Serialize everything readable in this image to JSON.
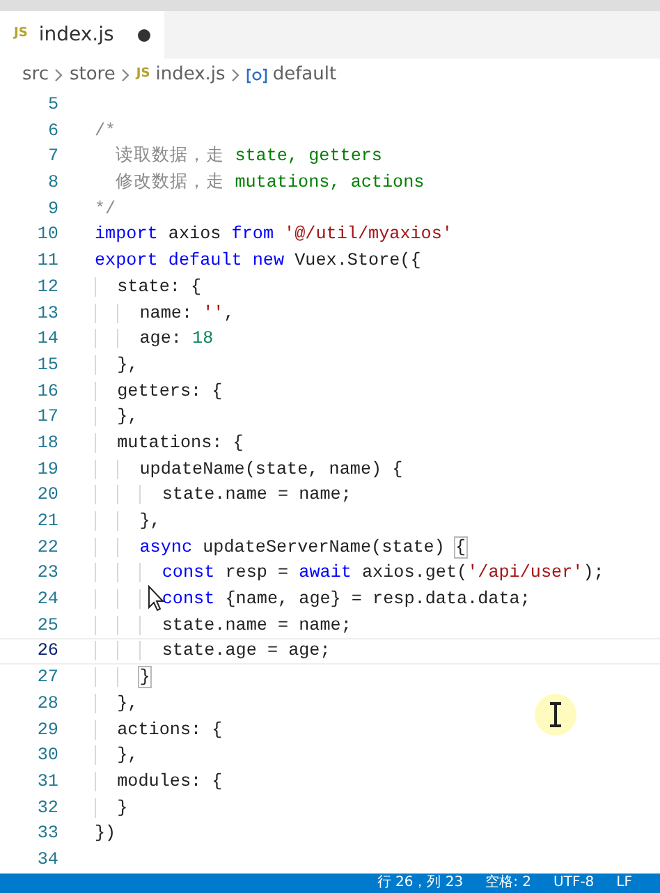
{
  "tab": {
    "icon_label": "JS",
    "title": "index.js",
    "modified": true,
    "selected": true
  },
  "breadcrumbs": [
    {
      "kind": "folder",
      "label": "src"
    },
    {
      "kind": "folder",
      "label": "store"
    },
    {
      "kind": "file",
      "icon_label": "JS",
      "label": "index.js"
    },
    {
      "kind": "symbol",
      "label": "default"
    }
  ],
  "lines": [
    {
      "number": "5",
      "selected": false
    },
    {
      "number": "6",
      "selected": false,
      "tokens": [
        {
          "kind": "comment",
          "text": "/*"
        }
      ]
    },
    {
      "number": "7",
      "selected": false,
      "tokens": [
        {
          "kind": "comment",
          "text": "  读取数据，走 "
        },
        {
          "kind": "comment-code",
          "text": "state, getters"
        }
      ]
    },
    {
      "number": "8",
      "selected": false,
      "tokens": [
        {
          "kind": "comment",
          "text": "  修改数据，走 "
        },
        {
          "kind": "comment-code",
          "text": "mutations, actions"
        }
      ]
    },
    {
      "number": "9",
      "selected": false,
      "tokens": [
        {
          "kind": "comment",
          "text": "*/"
        }
      ]
    },
    {
      "number": "10",
      "selected": false,
      "tokens": [
        {
          "kind": "keyword",
          "text": "import"
        },
        {
          "kind": "plain",
          "text": " axios "
        },
        {
          "kind": "keyword",
          "text": "from"
        },
        {
          "kind": "string",
          "text": " '@/util/myaxios'"
        }
      ]
    },
    {
      "number": "11",
      "selected": false,
      "tokens": [
        {
          "kind": "keyword",
          "text": "export default new"
        },
        {
          "kind": "plain",
          "text": " Vuex.Store({"
        }
      ]
    },
    {
      "number": "12",
      "selected": false,
      "tokens": [
        {
          "kind": "plain",
          "text": "  state: {"
        }
      ]
    },
    {
      "number": "13",
      "selected": false,
      "tokens": [
        {
          "kind": "plain",
          "text": "    name: "
        },
        {
          "kind": "string",
          "text": "''"
        },
        {
          "kind": "plain",
          "text": ","
        }
      ]
    },
    {
      "number": "14",
      "selected": false,
      "tokens": [
        {
          "kind": "plain",
          "text": "    age: "
        },
        {
          "kind": "number",
          "text": "18"
        }
      ]
    },
    {
      "number": "15",
      "selected": false,
      "tokens": [
        {
          "kind": "plain",
          "text": "  },"
        }
      ]
    },
    {
      "number": "16",
      "selected": false,
      "tokens": [
        {
          "kind": "plain",
          "text": "  getters: {"
        }
      ]
    },
    {
      "number": "17",
      "selected": false,
      "tokens": [
        {
          "kind": "plain",
          "text": "  },"
        }
      ]
    },
    {
      "number": "18",
      "selected": false,
      "tokens": [
        {
          "kind": "plain",
          "text": "  mutations: {"
        }
      ]
    },
    {
      "number": "19",
      "selected": false,
      "tokens": [
        {
          "kind": "plain",
          "text": "    updateName(state, name) {"
        }
      ]
    },
    {
      "number": "20",
      "selected": false,
      "tokens": [
        {
          "kind": "plain",
          "text": "      state.name = name;"
        }
      ]
    },
    {
      "number": "21",
      "selected": false,
      "tokens": [
        {
          "kind": "plain",
          "text": "    },"
        }
      ]
    },
    {
      "number": "22",
      "selected": false,
      "tokens": [
        {
          "kind": "keyword",
          "text": "    async"
        },
        {
          "kind": "plain",
          "text": " updateServerName(state) "
        },
        {
          "kind": "bracket-match",
          "text": "{"
        }
      ]
    },
    {
      "number": "23",
      "selected": false,
      "tokens": [
        {
          "kind": "keyword",
          "text": "      const"
        },
        {
          "kind": "plain",
          "text": " resp = "
        },
        {
          "kind": "keyword",
          "text": "await"
        },
        {
          "kind": "plain",
          "text": " axios.get("
        },
        {
          "kind": "string",
          "text": "'/api/user'"
        },
        {
          "kind": "plain",
          "text": ");"
        }
      ]
    },
    {
      "number": "24",
      "selected": false,
      "tokens": [
        {
          "kind": "keyword",
          "text": "      const"
        },
        {
          "kind": "plain",
          "text": " {name, age} = resp.data.data;"
        }
      ]
    },
    {
      "number": "25",
      "selected": false,
      "tokens": [
        {
          "kind": "plain",
          "text": "      state.name = name;"
        }
      ]
    },
    {
      "number": "26",
      "selected": true,
      "tokens": [
        {
          "kind": "plain",
          "text": "      state.age = age;"
        }
      ]
    },
    {
      "number": "27",
      "selected": false,
      "tokens": [
        {
          "kind": "bracket-match",
          "text": "    }"
        }
      ]
    },
    {
      "number": "28",
      "selected": false,
      "tokens": [
        {
          "kind": "plain",
          "text": "  },"
        }
      ]
    },
    {
      "number": "29",
      "selected": false,
      "tokens": [
        {
          "kind": "plain",
          "text": "  actions: {"
        }
      ]
    },
    {
      "number": "30",
      "selected": false,
      "tokens": [
        {
          "kind": "plain",
          "text": "  },"
        }
      ]
    },
    {
      "number": "31",
      "selected": false,
      "tokens": [
        {
          "kind": "plain",
          "text": "  modules: {"
        }
      ]
    },
    {
      "number": "32",
      "selected": false,
      "tokens": [
        {
          "kind": "plain",
          "text": "  }"
        }
      ]
    },
    {
      "number": "33",
      "selected": false,
      "tokens": [
        {
          "kind": "plain",
          "text": "})"
        }
      ]
    },
    {
      "number": "34",
      "selected": false
    }
  ],
  "status_bar": [
    "行 26，列 23",
    "空格: 2",
    "UTF-8",
    "LF"
  ]
}
